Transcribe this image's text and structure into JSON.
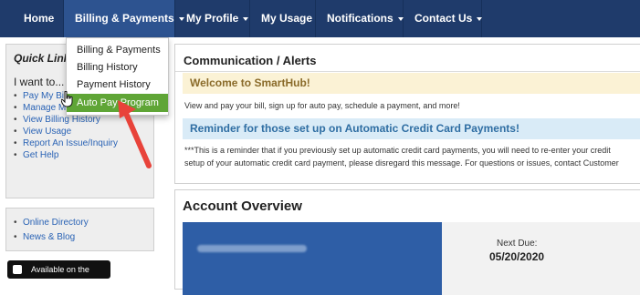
{
  "nav": {
    "items": [
      {
        "label": "Home",
        "caret": false
      },
      {
        "label": "Billing & Payments",
        "caret": true
      },
      {
        "label": "My Profile",
        "caret": true
      },
      {
        "label": "My Usage",
        "caret": false
      },
      {
        "label": "Notifications",
        "caret": true
      },
      {
        "label": "Contact Us",
        "caret": true
      }
    ],
    "colors": {
      "bar": "#1f3b6b",
      "active": "#2d5390"
    }
  },
  "dropdown": {
    "items": [
      {
        "label": "Billing & Payments"
      },
      {
        "label": "Billing History"
      },
      {
        "label": "Payment History"
      },
      {
        "label": "Auto Pay Program",
        "highlighted": true
      }
    ],
    "highlight_color": "#5fa536"
  },
  "sidebar": {
    "title": "Quick Links",
    "subtitle": "I want to...",
    "links": [
      "Pay My Bill",
      "Manage My Accounts",
      "View Billing History",
      "View Usage",
      "Report An Issue/Inquiry",
      "Get Help"
    ],
    "links2": [
      "Online Directory",
      "News & Blog"
    ],
    "appstore": "Available on the"
  },
  "communication": {
    "title": "Communication / Alerts",
    "welcome_title": "Welcome to SmartHub!",
    "welcome_text": "View and pay your bill, sign up for auto pay, schedule a payment, and more!",
    "reminder_title": "Reminder for those set up on Automatic Credit Card Payments!",
    "reminder_line1": "***This is a reminder that if you previously set up automatic credit card payments, you will need to re-enter your credit",
    "reminder_line2": "setup of your automatic credit card payment, please disregard this message. For questions or issues, contact Customer"
  },
  "account": {
    "title": "Account Overview",
    "next_due_label": "Next Due:",
    "next_due_date": "05/20/2020"
  },
  "icons": {
    "pointer": "hand-pointer-icon",
    "arrow": "red-arrow-icon"
  }
}
